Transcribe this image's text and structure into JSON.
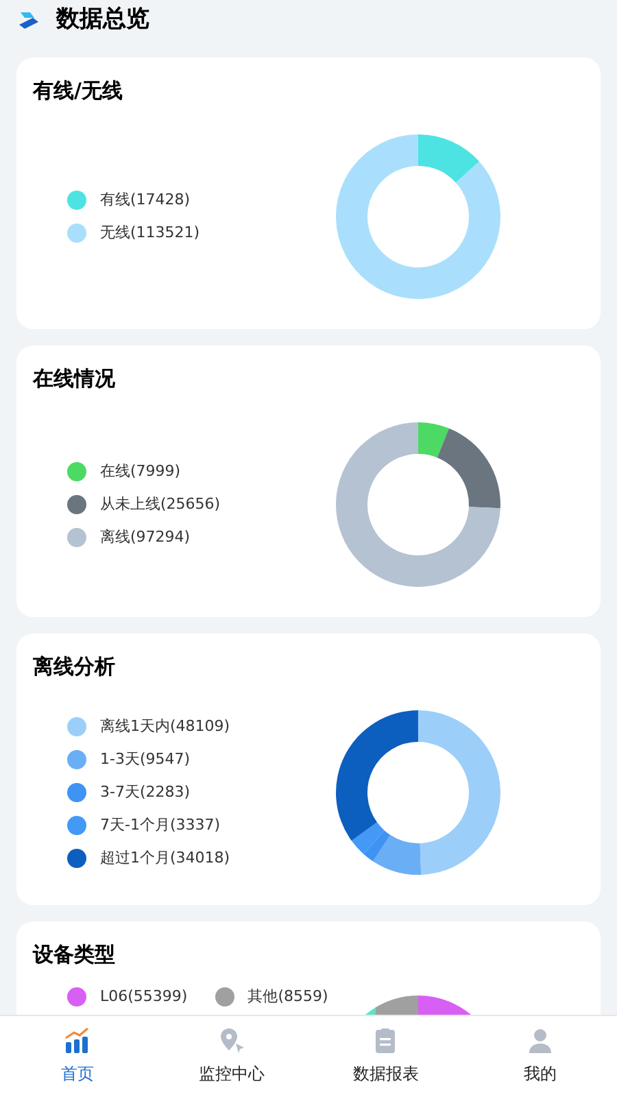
{
  "header": {
    "title": "数据总览"
  },
  "cards": [
    {
      "title": "有线/无线",
      "legend": [
        {
          "label": "有线(17428)",
          "color": "#4de3e3"
        },
        {
          "label": "无线(113521)",
          "color": "#a9dffc"
        }
      ],
      "chart_data": {
        "type": "donut",
        "values": [
          13.31,
          86.69
        ]
      }
    },
    {
      "title": "在线情况",
      "legend": [
        {
          "label": "在线(7999)",
          "color": "#4cd964"
        },
        {
          "label": "从未上线(25656)",
          "color": "#6b7580"
        },
        {
          "label": "离线(97294)",
          "color": "#b4c2d2"
        }
      ],
      "chart_data": {
        "type": "donut",
        "values": [
          6.11,
          19.59,
          74.3
        ]
      }
    },
    {
      "title": "离线分析",
      "legend": [
        {
          "label": "离线1天内(48109)",
          "color": "#9ccefa"
        },
        {
          "label": "1-3天(9547)",
          "color": "#6aaef5"
        },
        {
          "label": "3-7天(2283)",
          "color": "#3e94f3"
        },
        {
          "label": "7天-1个月(3337)",
          "color": "#4399f5"
        },
        {
          "label": "超过1个月(34018)",
          "color": "#0d5fbf"
        }
      ],
      "chart_data": {
        "type": "donut",
        "values": [
          49.45,
          9.81,
          2.35,
          3.43,
          34.96
        ]
      }
    },
    {
      "title": "设备类型",
      "legend": [
        {
          "label": "L06(55399)",
          "color": "#d85ff3"
        },
        {
          "label": "其他(8559)",
          "color": "#a0a0a0"
        }
      ]
    }
  ],
  "tabs": [
    {
      "label": "首页",
      "selected": true
    },
    {
      "label": "监控中心",
      "selected": false
    },
    {
      "label": "数据报表",
      "selected": false
    },
    {
      "label": "我的",
      "selected": false
    }
  ]
}
